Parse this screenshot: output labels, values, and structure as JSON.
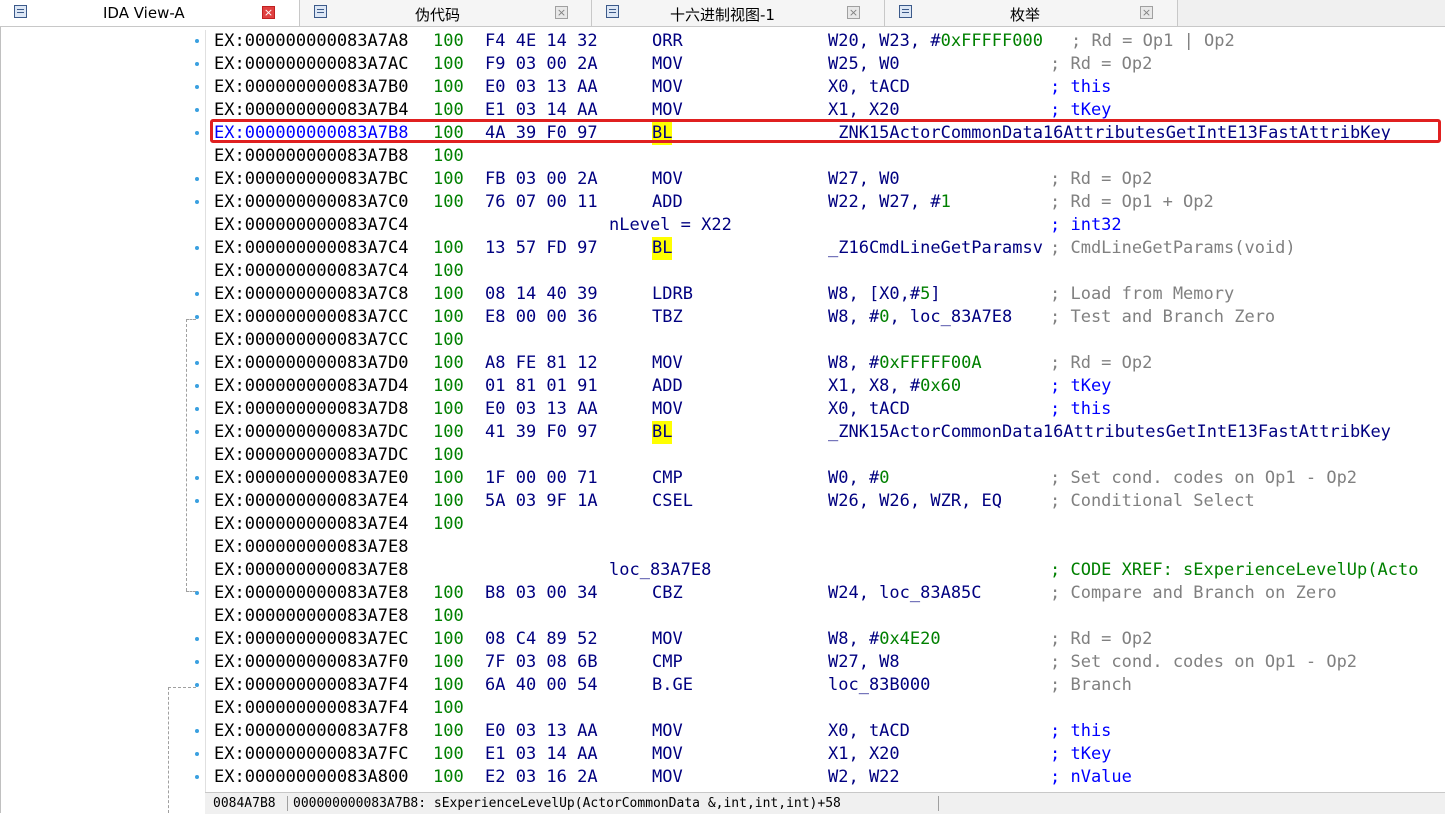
{
  "tabs": [
    {
      "label": "IDA View-A",
      "active": true
    },
    {
      "label": "伪代码",
      "active": false
    },
    {
      "label": "十六进制视图-1",
      "active": false
    },
    {
      "label": "枚举",
      "active": false
    }
  ],
  "rows": [
    {
      "addr": "EX:000000000083A7A8",
      "stk": "100",
      "bytes": "F4 4E 14 32",
      "label": "",
      "mnem": "ORR",
      "ops": "W20, W23, #0xFFFFF000",
      "cmt": "; Rd = Op1 | Op2",
      "cmt_style": "gray",
      "cmt_x": "pre"
    },
    {
      "addr": "EX:000000000083A7AC",
      "stk": "100",
      "bytes": "F9 03 00 2A",
      "label": "",
      "mnem": "MOV",
      "ops": "W25, W0",
      "cmt": "; Rd = Op2",
      "cmt_style": "gray"
    },
    {
      "addr": "EX:000000000083A7B0",
      "stk": "100",
      "bytes": "E0 03 13 AA",
      "label": "",
      "mnem": "MOV",
      "ops": "X0, tACD",
      "cmt": "; this",
      "cmt_style": "blue"
    },
    {
      "addr": "EX:000000000083A7B4",
      "stk": "100",
      "bytes": "E1 03 14 AA",
      "label": "",
      "mnem": "MOV",
      "ops": "X1, X20",
      "cmt": "; tKey",
      "cmt_style": "blue"
    },
    {
      "addr": "EX:000000000083A7B8",
      "stk": "100",
      "bytes": "4A 39 F0 97",
      "label": "",
      "mnem": "BL",
      "ops": "_ZNK15ActorCommonData16AttributesGetIntE13FastAttribKey",
      "cmt": "",
      "cmt_style": "gray",
      "highlight": true
    },
    {
      "addr": "EX:000000000083A7B8",
      "stk": "100",
      "bytes": "",
      "label": "",
      "mnem": "",
      "ops": "",
      "cmt": ""
    },
    {
      "addr": "EX:000000000083A7BC",
      "stk": "100",
      "bytes": "FB 03 00 2A",
      "label": "",
      "mnem": "MOV",
      "ops": "W27, W0",
      "cmt": "; Rd = Op2",
      "cmt_style": "gray"
    },
    {
      "addr": "EX:000000000083A7C0",
      "stk": "100",
      "bytes": "76 07 00 11",
      "label": "",
      "mnem": "ADD",
      "ops": "W22, W27, #1",
      "cmt": "; Rd = Op1 + Op2",
      "cmt_style": "gray"
    },
    {
      "addr": "EX:000000000083A7C4",
      "stk": "",
      "bytes": "",
      "label": "nLevel = X22",
      "mnem": "",
      "ops": "",
      "cmt": "; int32",
      "cmt_style": "blue"
    },
    {
      "addr": "EX:000000000083A7C4",
      "stk": "100",
      "bytes": "13 57 FD 97",
      "label": "",
      "mnem": "BL",
      "ops": "_Z16CmdLineGetParamsv",
      "cmt": "; CmdLineGetParams(void)",
      "cmt_style": "gray"
    },
    {
      "addr": "EX:000000000083A7C4",
      "stk": "100",
      "bytes": "",
      "label": "",
      "mnem": "",
      "ops": "",
      "cmt": ""
    },
    {
      "addr": "EX:000000000083A7C8",
      "stk": "100",
      "bytes": "08 14 40 39",
      "label": "",
      "mnem": "LDRB",
      "ops": "W8, [X0,#5]",
      "cmt": "; Load from Memory",
      "cmt_style": "gray"
    },
    {
      "addr": "EX:000000000083A7CC",
      "stk": "100",
      "bytes": "E8 00 00 36",
      "label": "",
      "mnem": "TBZ",
      "ops": "W8, #0, loc_83A7E8",
      "cmt": "; Test and Branch Zero",
      "cmt_style": "gray"
    },
    {
      "addr": "EX:000000000083A7CC",
      "stk": "100",
      "bytes": "",
      "label": "",
      "mnem": "",
      "ops": "",
      "cmt": ""
    },
    {
      "addr": "EX:000000000083A7D0",
      "stk": "100",
      "bytes": "A8 FE 81 12",
      "label": "",
      "mnem": "MOV",
      "ops": "W8, #0xFFFFF00A",
      "cmt": "; Rd = Op2",
      "cmt_style": "gray"
    },
    {
      "addr": "EX:000000000083A7D4",
      "stk": "100",
      "bytes": "01 81 01 91",
      "label": "",
      "mnem": "ADD",
      "ops": "X1, X8, #0x60",
      "cmt": "; tKey",
      "cmt_style": "blue"
    },
    {
      "addr": "EX:000000000083A7D8",
      "stk": "100",
      "bytes": "E0 03 13 AA",
      "label": "",
      "mnem": "MOV",
      "ops": "X0, tACD",
      "cmt": "; this",
      "cmt_style": "blue"
    },
    {
      "addr": "EX:000000000083A7DC",
      "stk": "100",
      "bytes": "41 39 F0 97",
      "label": "",
      "mnem": "BL",
      "ops": "_ZNK15ActorCommonData16AttributesGetIntE13FastAttribKey",
      "cmt": ""
    },
    {
      "addr": "EX:000000000083A7DC",
      "stk": "100",
      "bytes": "",
      "label": "",
      "mnem": "",
      "ops": "",
      "cmt": ""
    },
    {
      "addr": "EX:000000000083A7E0",
      "stk": "100",
      "bytes": "1F 00 00 71",
      "label": "",
      "mnem": "CMP",
      "ops": "W0, #0",
      "cmt": "; Set cond. codes on Op1 - Op2",
      "cmt_style": "gray"
    },
    {
      "addr": "EX:000000000083A7E4",
      "stk": "100",
      "bytes": "5A 03 9F 1A",
      "label": "",
      "mnem": "CSEL",
      "ops": "W26, W26, WZR, EQ",
      "cmt": "; Conditional Select",
      "cmt_style": "gray"
    },
    {
      "addr": "EX:000000000083A7E4",
      "stk": "100",
      "bytes": "",
      "label": "",
      "mnem": "",
      "ops": "",
      "cmt": ""
    },
    {
      "addr": "EX:000000000083A7E8",
      "stk": "",
      "bytes": "",
      "label": "",
      "mnem": "",
      "ops": "",
      "cmt": ""
    },
    {
      "addr": "EX:000000000083A7E8",
      "stk": "",
      "bytes": "",
      "label": "loc_83A7E8",
      "mnem": "",
      "ops": "",
      "cmt": "; CODE XREF: sExperienceLevelUp(Acto",
      "cmt_style": "green"
    },
    {
      "addr": "EX:000000000083A7E8",
      "stk": "100",
      "bytes": "B8 03 00 34",
      "label": "",
      "mnem": "CBZ",
      "ops": "W24, loc_83A85C",
      "cmt": "; Compare and Branch on Zero",
      "cmt_style": "gray"
    },
    {
      "addr": "EX:000000000083A7E8",
      "stk": "100",
      "bytes": "",
      "label": "",
      "mnem": "",
      "ops": "",
      "cmt": ""
    },
    {
      "addr": "EX:000000000083A7EC",
      "stk": "100",
      "bytes": "08 C4 89 52",
      "label": "",
      "mnem": "MOV",
      "ops": "W8, #0x4E20",
      "cmt": "; Rd = Op2",
      "cmt_style": "gray"
    },
    {
      "addr": "EX:000000000083A7F0",
      "stk": "100",
      "bytes": "7F 03 08 6B",
      "label": "",
      "mnem": "CMP",
      "ops": "W27, W8",
      "cmt": "; Set cond. codes on Op1 - Op2",
      "cmt_style": "gray"
    },
    {
      "addr": "EX:000000000083A7F4",
      "stk": "100",
      "bytes": "6A 40 00 54",
      "label": "",
      "mnem": "B.GE",
      "ops": "loc_83B000",
      "cmt": "; Branch",
      "cmt_style": "gray"
    },
    {
      "addr": "EX:000000000083A7F4",
      "stk": "100",
      "bytes": "",
      "label": "",
      "mnem": "",
      "ops": "",
      "cmt": ""
    },
    {
      "addr": "EX:000000000083A7F8",
      "stk": "100",
      "bytes": "E0 03 13 AA",
      "label": "",
      "mnem": "MOV",
      "ops": "X0, tACD",
      "cmt": "; this",
      "cmt_style": "blue"
    },
    {
      "addr": "EX:000000000083A7FC",
      "stk": "100",
      "bytes": "E1 03 14 AA",
      "label": "",
      "mnem": "MOV",
      "ops": "X1, X20",
      "cmt": "; tKey",
      "cmt_style": "blue"
    },
    {
      "addr": "EX:000000000083A800",
      "stk": "100",
      "bytes": "E2 03 16 2A",
      "label": "",
      "mnem": "MOV",
      "ops": "W2, W22",
      "cmt": "; nValue",
      "cmt_style": "blue"
    }
  ],
  "status": {
    "file_offset": "0084A7B8",
    "location": "000000000083A7B8: sExperienceLevelUp(ActorCommonData &,int,int,int)+58"
  },
  "colors": {
    "address": "#000000",
    "stack": "#008000",
    "code": "#000080",
    "comment_gray": "#808080",
    "comment_blue": "#0000ff",
    "highlight_box": "#e02020",
    "bl_background": "#ffff00"
  }
}
